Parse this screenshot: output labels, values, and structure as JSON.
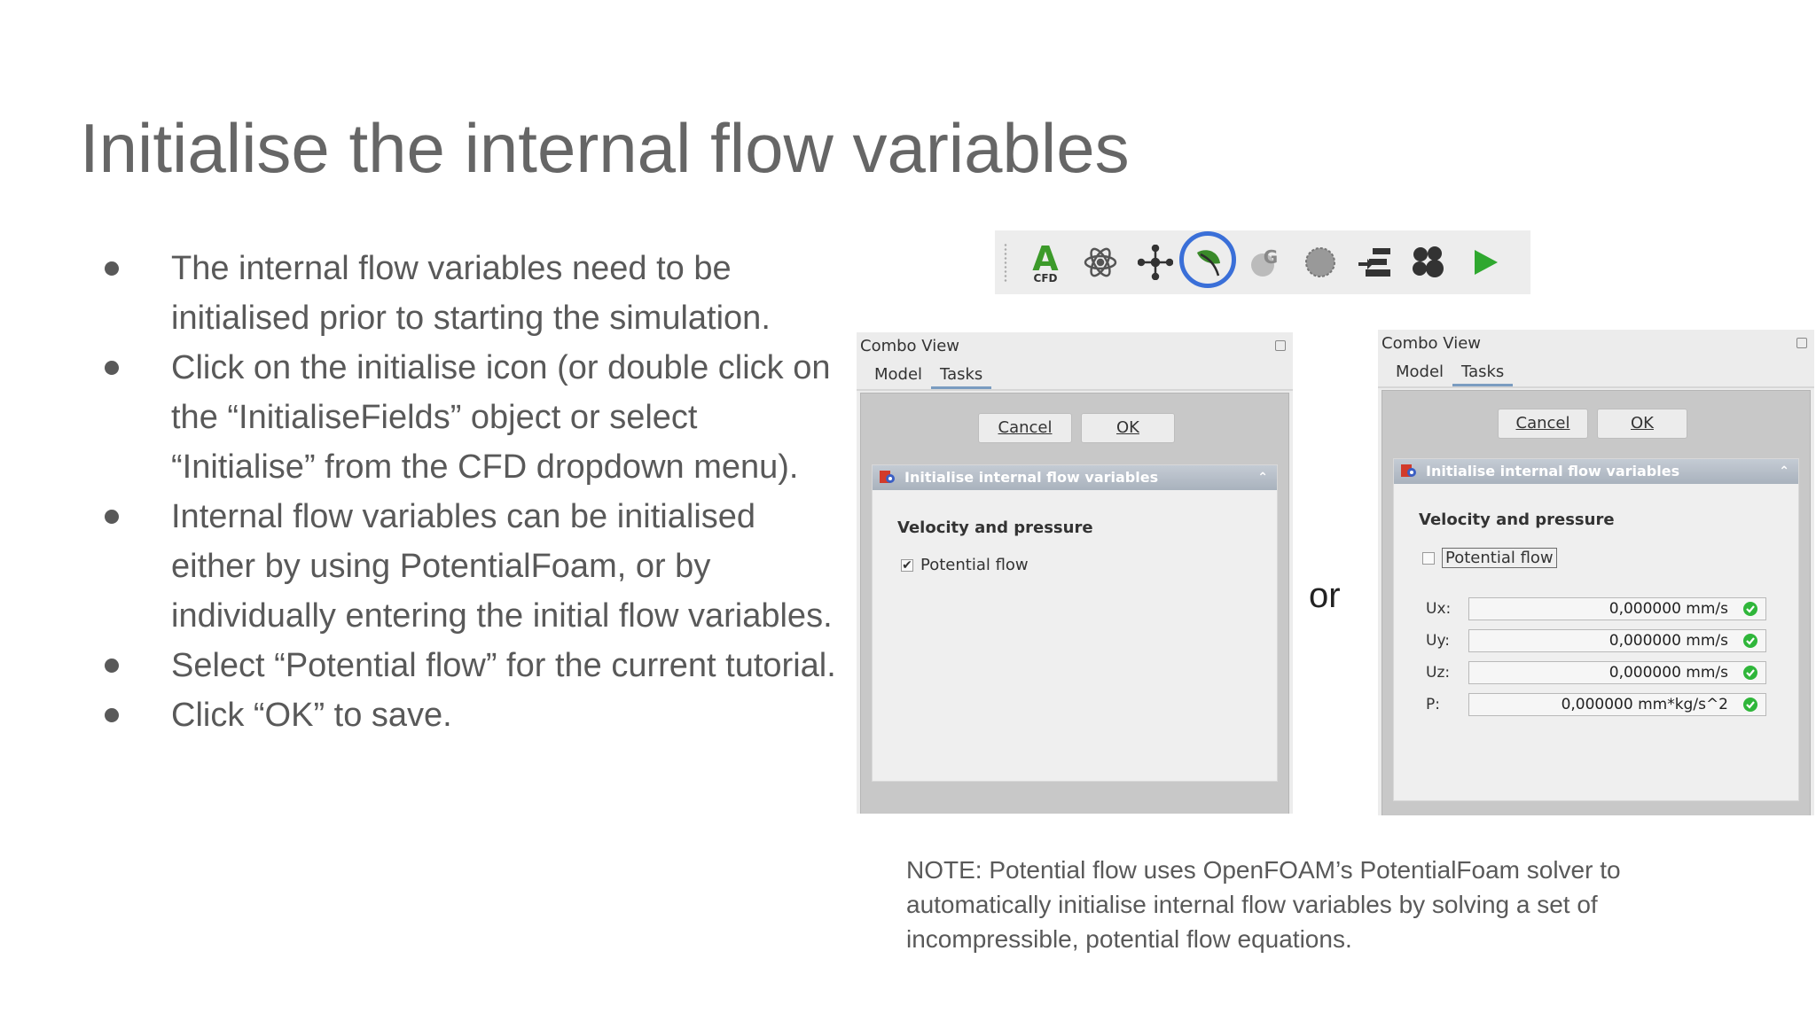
{
  "slide": {
    "title": "Initialise the internal flow variables",
    "bullets": [
      "The internal flow variables need to be initialised prior to starting the simulation.",
      "Click on the initialise icon (or double click on the “InitialiseFields” object or select “Initialise” from the CFD dropdown menu).",
      "Internal flow variables can be initialised either by using PotentialFoam, or by individually entering the initial flow variables.",
      "Select “Potential flow” for the current tutorial.",
      "Click “OK” to save."
    ],
    "or_text": "or",
    "note": "NOTE: Potential flow uses OpenFOAM’s PotentialFoam solver to automatically initialise internal flow variables by solving a set of incompressible, potential flow equations."
  },
  "toolbar": {
    "icons": [
      "cfd-analysis-icon",
      "atom-physics-icon",
      "mesh-nodes-icon",
      "initialise-leaf-icon",
      "gmsh-icon",
      "mesh-sphere-icon",
      "solver-settings-icon",
      "fluid-materials-icon",
      "run-solver-icon"
    ],
    "cfd_icon_letter": "A",
    "cfd_icon_label": "CFD",
    "highlighted_icon": "initialise-leaf-icon",
    "highlight_color": "#3a6fd8"
  },
  "panel_left": {
    "header": "Combo View",
    "tabs": [
      "Model",
      "Tasks"
    ],
    "active_tab": "Tasks",
    "cancel_label": "Cancel",
    "ok_label": "OK",
    "group_title": "Initialise internal flow variables",
    "section_label": "Velocity and pressure",
    "checkbox_label": "Potential flow",
    "checkbox_checked": true
  },
  "panel_right": {
    "header": "Combo View",
    "tabs": [
      "Model",
      "Tasks"
    ],
    "active_tab": "Tasks",
    "cancel_label": "Cancel",
    "ok_label": "OK",
    "group_title": "Initialise internal flow variables",
    "section_label": "Velocity and pressure",
    "checkbox_label": "Potential flow",
    "checkbox_checked": false,
    "fields": [
      {
        "label": "Ux:",
        "value": "0,000000 mm/s"
      },
      {
        "label": "Uy:",
        "value": "0,000000 mm/s"
      },
      {
        "label": "Uz:",
        "value": "0,000000 mm/s"
      },
      {
        "label": "P:",
        "value": "0,000000 mm*kg/s^2"
      }
    ]
  }
}
